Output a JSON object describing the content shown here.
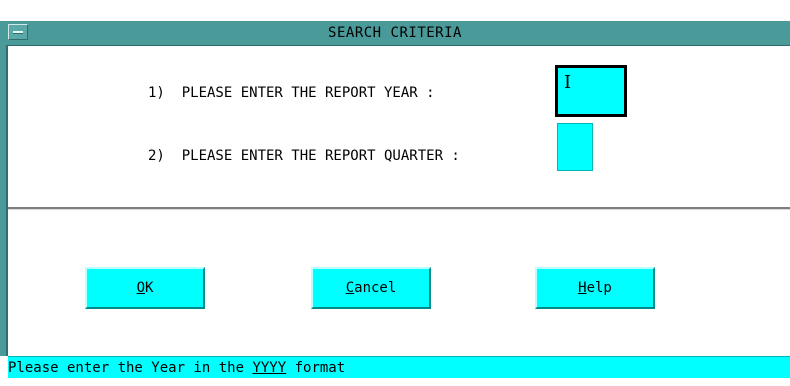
{
  "window": {
    "title": "SEARCH CRITERIA"
  },
  "form": {
    "year_label": "1)  PLEASE ENTER THE REPORT YEAR :",
    "year_value": "",
    "quarter_label": "2)  PLEASE ENTER THE REPORT QUARTER :",
    "quarter_value": ""
  },
  "buttons": {
    "ok_mnemonic": "O",
    "ok_rest": "K",
    "cancel_mnemonic": "C",
    "cancel_rest": "ancel",
    "help_mnemonic": "H",
    "help_rest": "elp"
  },
  "status": {
    "text_before": "Please enter the Year in the ",
    "text_underlined": "YYYY",
    "text_after": " format"
  },
  "colors": {
    "field": "#00ffff",
    "titlebar": "#4a9a9a",
    "button": "#00ffff"
  },
  "icons": {
    "window_menu": "window-menu-icon",
    "text_caret": "text-cursor-icon"
  }
}
